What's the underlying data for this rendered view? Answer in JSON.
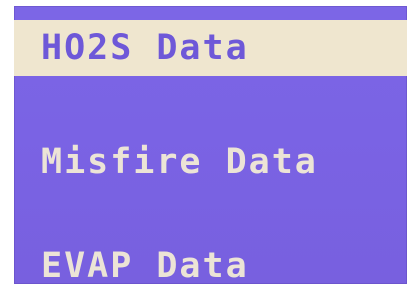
{
  "menu": {
    "items": [
      {
        "label": "HO2S Data",
        "selected": true
      },
      {
        "label": "Misfire Data",
        "selected": false
      },
      {
        "label": "EVAP Data",
        "selected": false
      }
    ]
  },
  "colors": {
    "screen_background": "#7a63e4",
    "selected_highlight": "#efe6cf",
    "selected_text": "#6e58d8",
    "normal_text": "#ece4d6"
  }
}
